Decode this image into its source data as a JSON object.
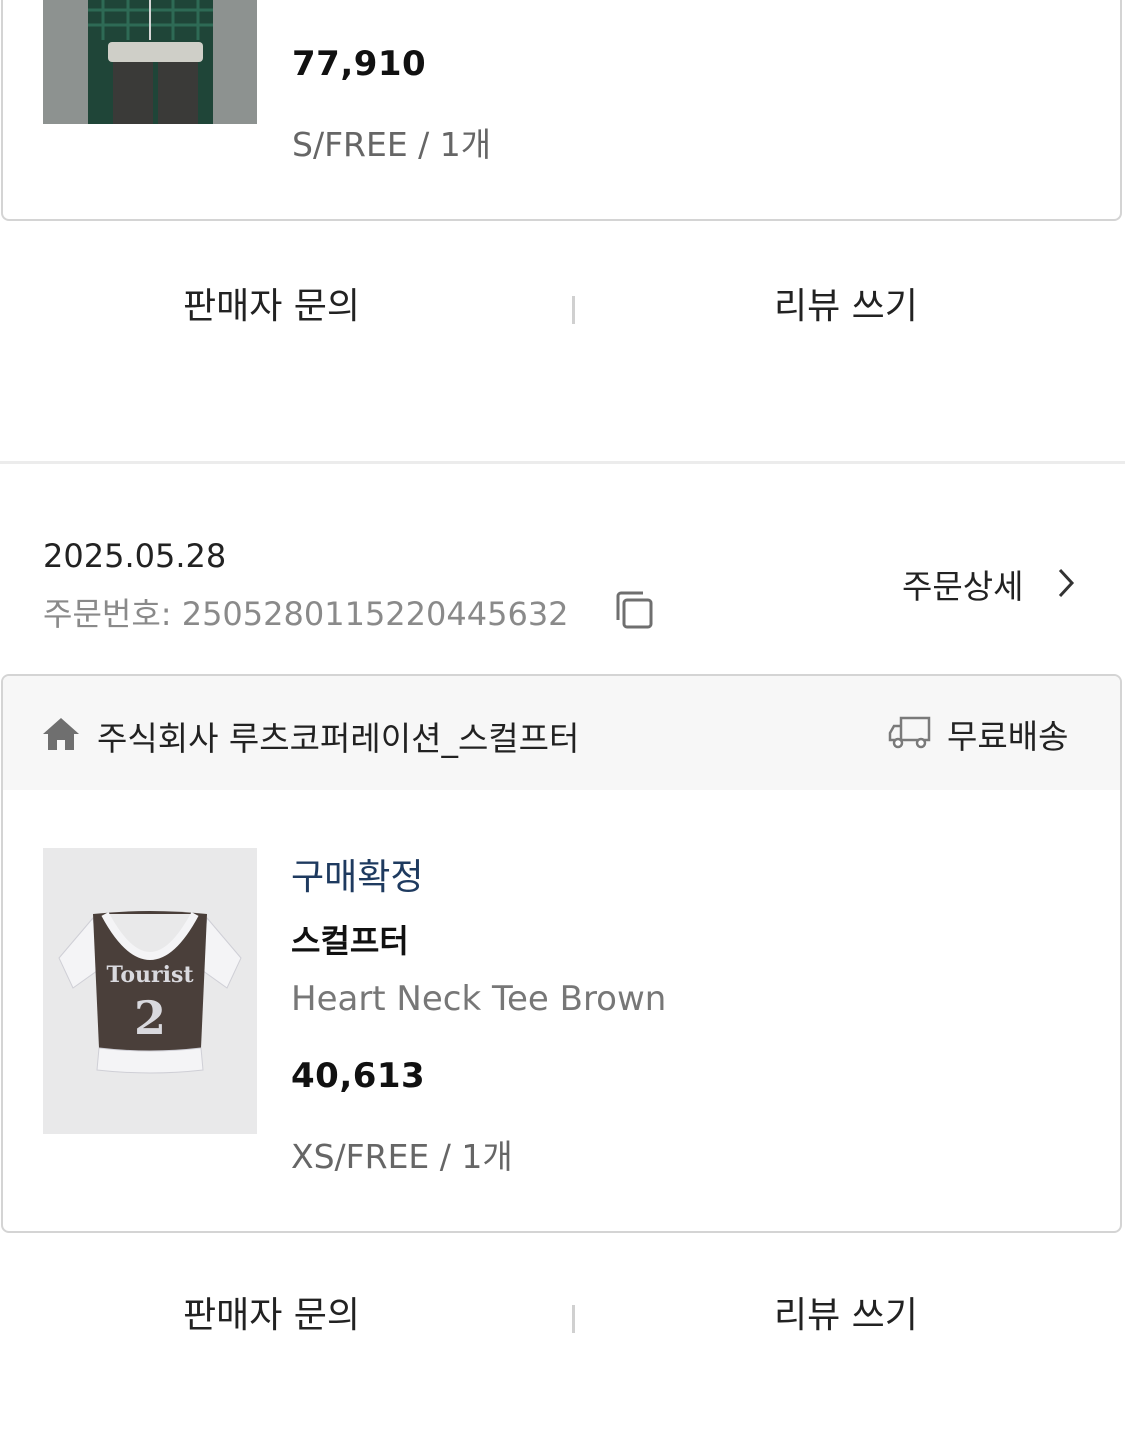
{
  "order_top": {
    "price": "77,910",
    "option": "S/FREE / 1개",
    "actions": {
      "inquiry": "판매자 문의",
      "review": "리뷰 쓰기"
    }
  },
  "order_main": {
    "date": "2025.05.28",
    "order_number": "주문번호: 2505280115220445632",
    "detail_link": "주문상세",
    "seller": "주식회사 루츠코퍼레이션_스컬프터",
    "shipping": "무료배송",
    "item": {
      "status": "구매확정",
      "brand": "스컬프터",
      "name": "Heart Neck Tee Brown",
      "price": "40,613",
      "option": "XS/FREE / 1개",
      "image_text": {
        "line1": "Tourist",
        "line2": "2"
      }
    },
    "actions": {
      "inquiry": "판매자 문의",
      "review": "리뷰 쓰기"
    }
  },
  "colors": {
    "status": "#1e3a5f",
    "border": "#d4d4d4",
    "header_bg": "#f7f7f7"
  },
  "icons": [
    "copy-icon",
    "chevron-right-icon",
    "store-icon",
    "truck-icon"
  ]
}
